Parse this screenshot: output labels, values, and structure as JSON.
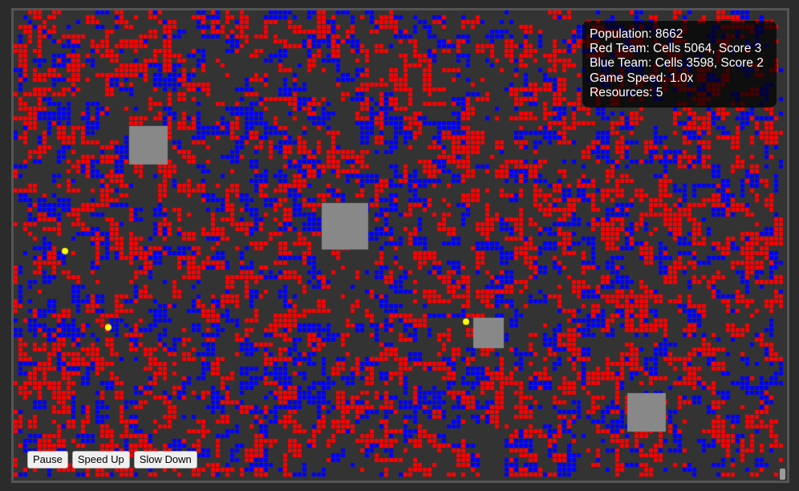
{
  "stats": {
    "population": "Population: 8662",
    "red_team": "Red Team: Cells 5064, Score 3",
    "blue_team": "Blue Team: Cells 3598, Score 2",
    "game_speed": "Game Speed: 1.0x",
    "resources": "Resources: 5"
  },
  "controls": {
    "pause_label": "Pause",
    "speed_up_label": "Speed Up",
    "slow_down_label": "Slow Down"
  },
  "colors": {
    "board_background": "#333333",
    "red_cell": "#ff0000",
    "blue_cell": "#0000ff",
    "obstacle": "#888888",
    "resource": "#ffff00"
  }
}
